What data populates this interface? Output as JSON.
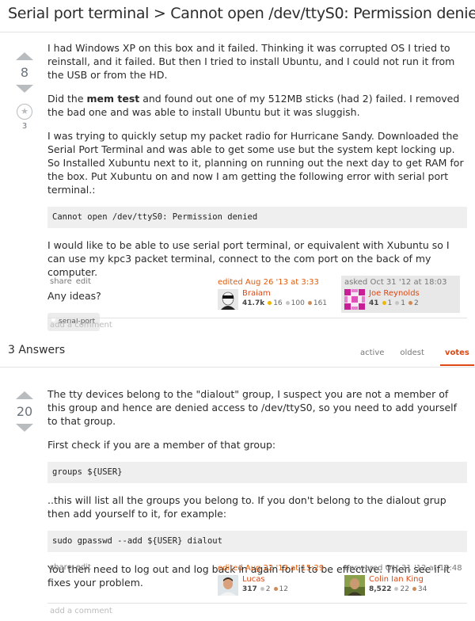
{
  "question": {
    "title": "Serial port terminal > Cannot open /dev/ttyS0: Permission denied",
    "votes": "8",
    "favorites": "3",
    "star_glyph": "★",
    "paragraphs": {
      "p1": "I had Windows XP on this box and it failed. Thinking it was corrupted OS I tried to reinstall, and it failed. But then I tried to install Ubuntu, and I could not run it from the USB or from the HD.",
      "p2_pre": "Did the ",
      "p2_bold": "mem test",
      "p2_post": " and found out one of my 512MB sticks (had 2) failed. I removed the bad one and was able to install Ubuntu but it was sluggish.",
      "p3": "I was trying to quickly setup my packet radio for Hurricane Sandy. Downloaded the Serial Port Terminal and was able to get some use but the system kept locking up. So Installed Xubuntu next to it, planning on running out the next day to get RAM for the box. Put Xubuntu on and now I am getting the following error with serial port terminal.:",
      "code": "Cannot open /dev/ttyS0: Permission denied",
      "p4": "I would like to be able to use serial port terminal, or equivalent with Xubuntu so I can use my kpc3 packet terminal, connect to the com port on the back of my computer.",
      "p5": "Any ideas?"
    },
    "tag": "serial-port",
    "share": "share",
    "edit": "edit",
    "add_comment": "add a comment",
    "edited": {
      "action": "edited Aug 26 '13 at 3:33",
      "user": "Braiam",
      "rep": "41.7k",
      "gold": "16",
      "silver": "100",
      "bronze": "161"
    },
    "asked": {
      "action": "asked Oct 31 '12 at 18:03",
      "user": "Joe Reynolds",
      "rep": "41",
      "gold": "1",
      "silver": "1",
      "bronze": "2"
    }
  },
  "answers_header": {
    "count_label": "3 Answers",
    "tabs": {
      "active": "active",
      "oldest": "oldest",
      "votes": "votes"
    }
  },
  "answer": {
    "votes": "20",
    "p1": "The tty devices belong to the \"dialout\" group, I suspect you are not a member of this group and hence are denied access to /dev/ttyS0, so you need to add yourself to that group.",
    "p2": "First check if you are a member of that group:",
    "code1": "groups ${USER}",
    "p3": "..this will list all the groups you belong to. If you don't belong to the dialout grup then add yourself to it, for example:",
    "code2": "sudo gpasswd --add ${USER} dialout",
    "p4": "You then need to log out and log back in again for it to be effective. Then see if it fixes your problem.",
    "share": "share",
    "edit": "edit",
    "add_comment": "add a comment",
    "edited": {
      "action": "edited Aug 22 '13 at 15:29",
      "user": "Lucas",
      "rep": "317",
      "silver": "2",
      "bronze": "12"
    },
    "answered": {
      "action": "answered Oct 31 '12 at 19:48",
      "user": "Colin Ian King",
      "rep": "8,522",
      "silver": "22",
      "bronze": "34"
    }
  },
  "colors": {
    "accent": "#dd4814",
    "badge_gold": "#f1b600",
    "badge_silver": "#c5c5c5",
    "badge_bronze": "#cd8b58"
  }
}
